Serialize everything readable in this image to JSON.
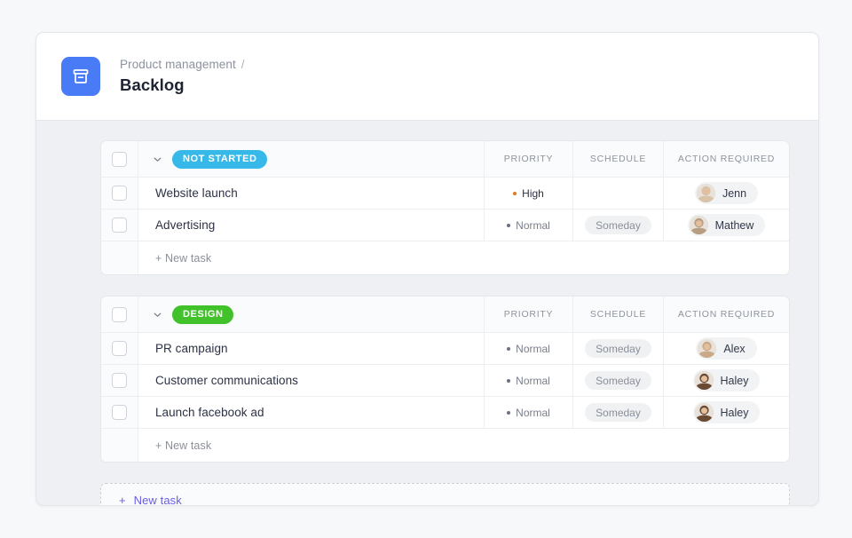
{
  "header": {
    "icon": "archive-box-icon",
    "icon_bg": "#4a7bf7",
    "breadcrumb_parent": "Product management",
    "breadcrumb_separator": "/",
    "title": "Backlog"
  },
  "columns": {
    "priority": "PRIORITY",
    "schedule": "SCHEDULE",
    "action_required": "ACTION REQUIRED"
  },
  "groups": [
    {
      "badge_label": "NOT STARTED",
      "badge_color": "#36b9e8",
      "chevron": "chevron-down-icon",
      "new_task_label": "+ New task",
      "tasks": [
        {
          "name": "Website launch",
          "priority": "High",
          "priority_level": "high",
          "priority_dot": "#e8761a",
          "schedule": "",
          "assignee": "Jenn",
          "avatar_tone": "#d8c3a8"
        },
        {
          "name": "Advertising",
          "priority": "Normal",
          "priority_level": "normal",
          "priority_dot": "#6b7180",
          "schedule": "Someday",
          "assignee": "Mathew",
          "avatar_tone": "#b79d82"
        }
      ]
    },
    {
      "badge_label": "DESIGN",
      "badge_color": "#41c22a",
      "chevron": "chevron-down-icon",
      "new_task_label": "+ New task",
      "tasks": [
        {
          "name": "PR campaign",
          "priority": "Normal",
          "priority_level": "normal",
          "priority_dot": "#6b7180",
          "schedule": "Someday",
          "assignee": "Alex",
          "avatar_tone": "#c9a989"
        },
        {
          "name": "Customer communications",
          "priority": "Normal",
          "priority_level": "normal",
          "priority_dot": "#6b7180",
          "schedule": "Someday",
          "assignee": "Haley",
          "avatar_tone": "#6b4a34"
        },
        {
          "name": "Launch facebook ad",
          "priority": "Normal",
          "priority_level": "normal",
          "priority_dot": "#6b7180",
          "schedule": "Someday",
          "assignee": "Haley",
          "avatar_tone": "#6b4a34"
        }
      ]
    }
  ],
  "footer": {
    "new_task_plus": "+",
    "new_task_label": "New task",
    "accent_color": "#6b5ce7"
  }
}
